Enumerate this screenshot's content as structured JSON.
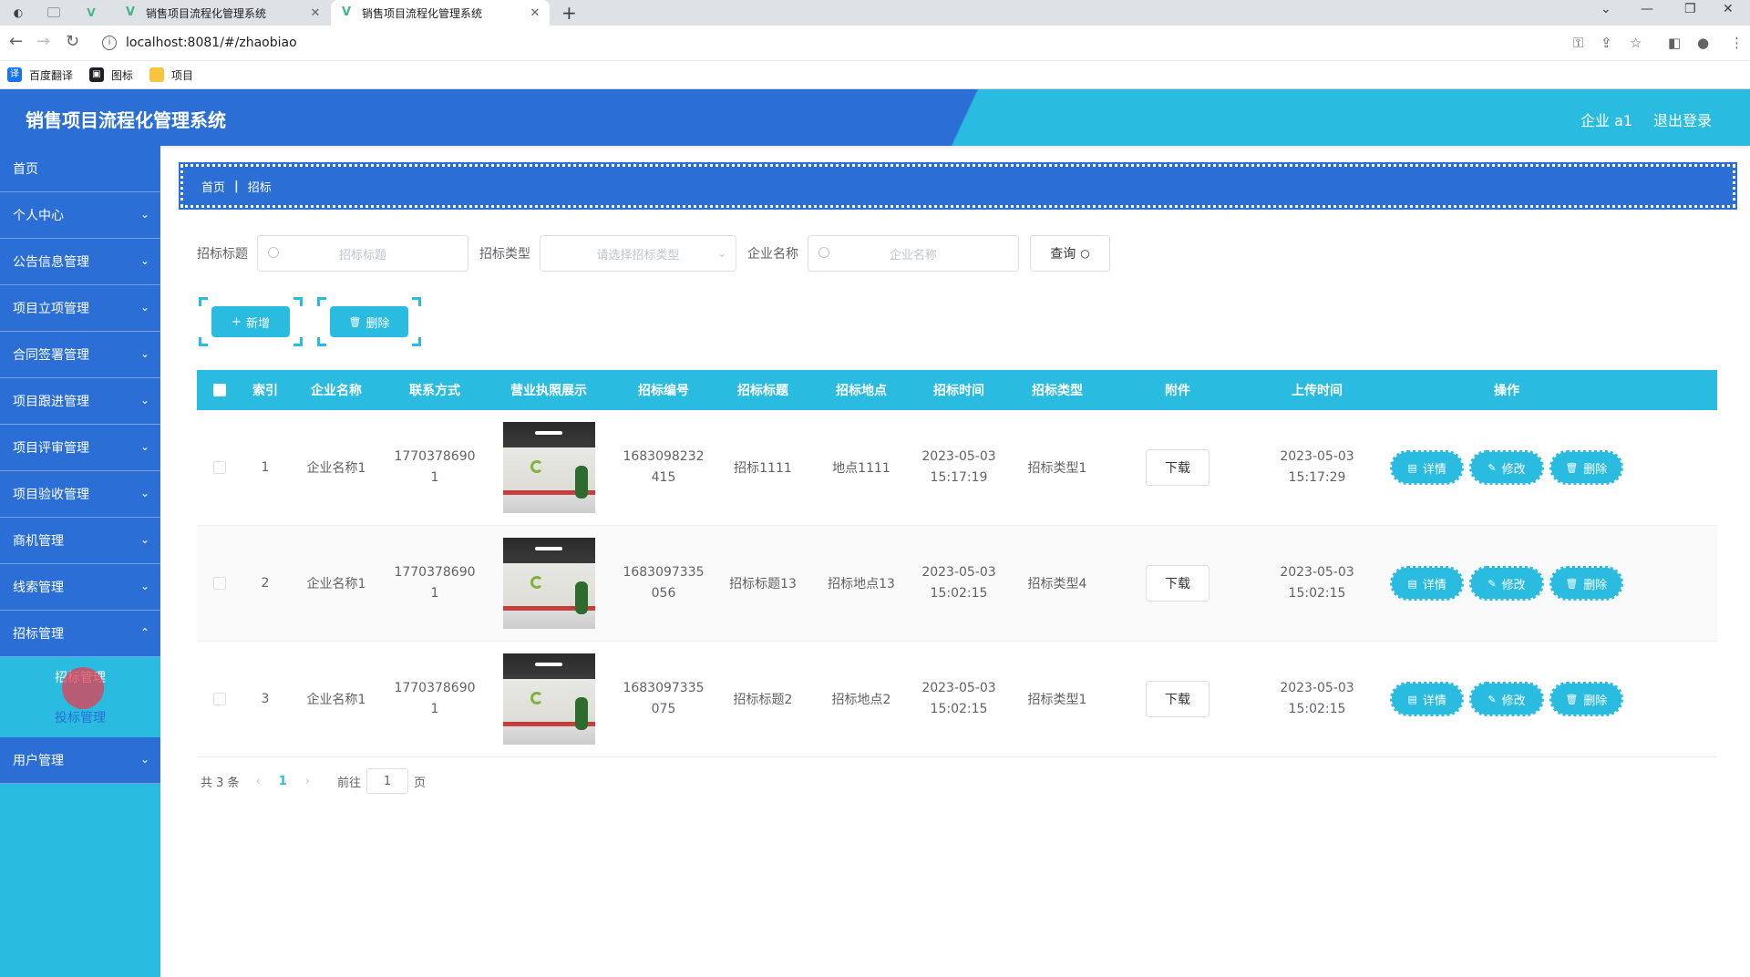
{
  "browser": {
    "tabs": [
      {
        "title": "销售项目流程化管理系统"
      },
      {
        "title": "销售项目流程化管理系统"
      }
    ],
    "url": "localhost:8081/#/zhaobiao",
    "bookmarks": [
      {
        "label": "百度翻译",
        "icon": "translate-icon",
        "color": "#1a73e8"
      },
      {
        "label": "图标",
        "icon": "image-icon",
        "color": "#202124"
      },
      {
        "label": "项目",
        "icon": "folder-icon",
        "color": "#f5c542"
      }
    ]
  },
  "header": {
    "title": "销售项目流程化管理系统",
    "user": "企业 a1",
    "logout": "退出登录"
  },
  "sidebar": {
    "items": [
      {
        "label": "首页",
        "expandable": false
      },
      {
        "label": "个人中心",
        "expandable": true
      },
      {
        "label": "公告信息管理",
        "expandable": true
      },
      {
        "label": "项目立项管理",
        "expandable": true
      },
      {
        "label": "合同签署管理",
        "expandable": true
      },
      {
        "label": "项目跟进管理",
        "expandable": true
      },
      {
        "label": "项目评审管理",
        "expandable": true
      },
      {
        "label": "项目验收管理",
        "expandable": true
      },
      {
        "label": "商机管理",
        "expandable": true
      },
      {
        "label": "线索管理",
        "expandable": true
      },
      {
        "label": "招标管理",
        "expandable": true
      }
    ],
    "submenu": [
      {
        "label": "招标管理",
        "active": true
      },
      {
        "label": "投标管理",
        "active": false
      }
    ],
    "last_item": {
      "label": "用户管理",
      "expandable": true
    }
  },
  "breadcrumb": {
    "home": "首页",
    "current": "招标"
  },
  "search": {
    "title_label": "招标标题",
    "title_placeholder": "招标标题",
    "type_label": "招标类型",
    "type_placeholder": "请选择招标类型",
    "company_label": "企业名称",
    "company_placeholder": "企业名称",
    "query_button": "查询"
  },
  "actions": {
    "add": "新增",
    "delete": "删除"
  },
  "table": {
    "columns": [
      "索引",
      "企业名称",
      "联系方式",
      "营业执照展示",
      "招标编号",
      "招标标题",
      "招标地点",
      "招标时间",
      "招标类型",
      "附件",
      "上传时间",
      "操作"
    ],
    "rows": [
      {
        "index": "1",
        "company": "企业名称1",
        "phone_l1": "1770378690",
        "phone_l2": "1",
        "code_l1": "1683098232",
        "code_l2": "415",
        "title": "招标1111",
        "location": "地点1111",
        "time_l1": "2023-05-03",
        "time_l2": "15:17:19",
        "type": "招标类型1",
        "attachment": "下载",
        "upload_l1": "2023-05-03",
        "upload_l2": "15:17:29"
      },
      {
        "index": "2",
        "company": "企业名称1",
        "phone_l1": "1770378690",
        "phone_l2": "1",
        "code_l1": "1683097335",
        "code_l2": "056",
        "title": "招标标题13",
        "location": "招标地点13",
        "time_l1": "2023-05-03",
        "time_l2": "15:02:15",
        "type": "招标类型4",
        "attachment": "下载",
        "upload_l1": "2023-05-03",
        "upload_l2": "15:02:15"
      },
      {
        "index": "3",
        "company": "企业名称1",
        "phone_l1": "1770378690",
        "phone_l2": "1",
        "code_l1": "1683097335",
        "code_l2": "075",
        "title": "招标标题2",
        "location": "招标地点2",
        "time_l1": "2023-05-03",
        "time_l2": "15:02:15",
        "type": "招标类型1",
        "attachment": "下载",
        "upload_l1": "2023-05-03",
        "upload_l2": "15:02:15"
      }
    ],
    "row_actions": {
      "detail": "详情",
      "edit": "修改",
      "delete": "删除"
    }
  },
  "pagination": {
    "total": "共 3 条",
    "current_page": "1",
    "goto_label": "前往",
    "goto_value": "1",
    "page_suffix": "页"
  },
  "colors": {
    "primary_blue": "#2b6fd6",
    "accent_cyan": "#29bce0"
  }
}
